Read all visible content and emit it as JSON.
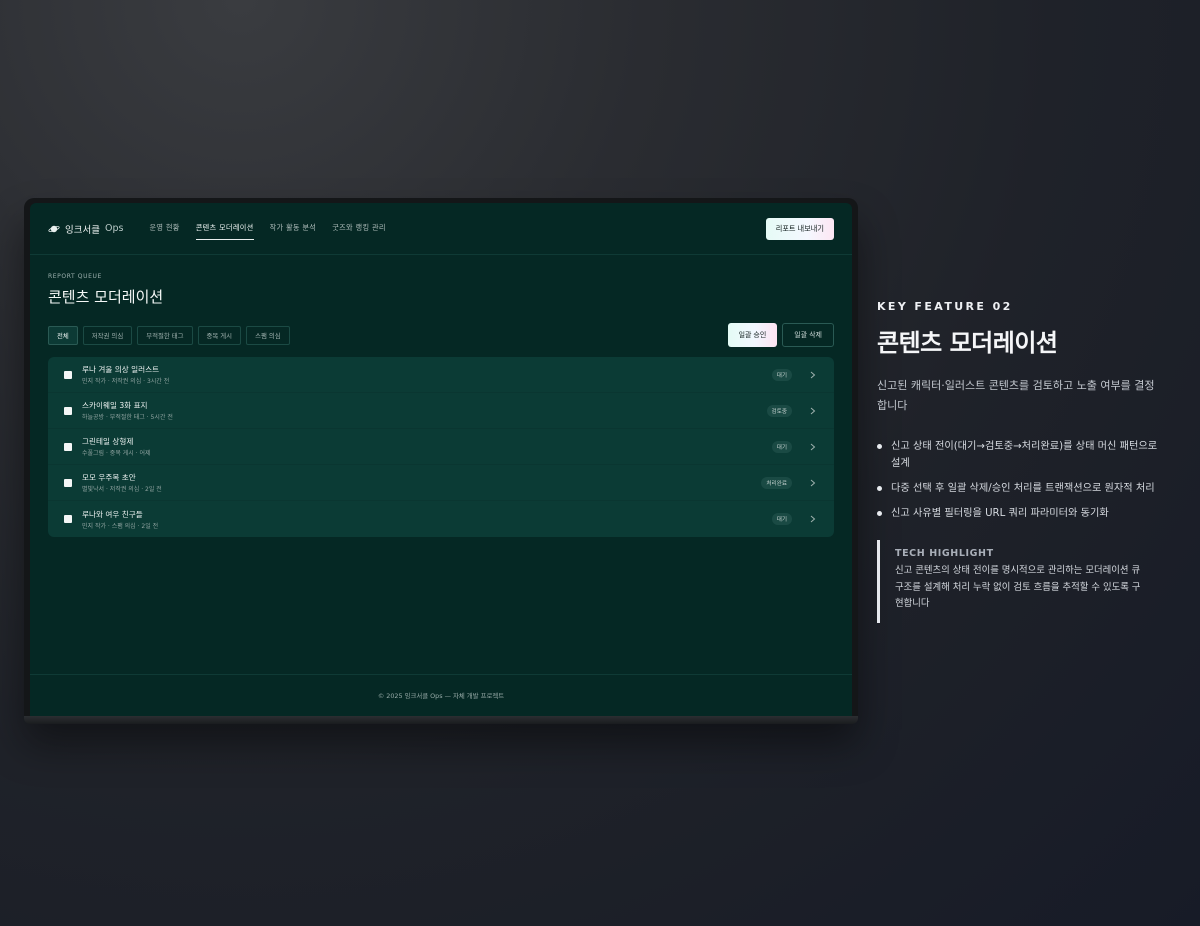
{
  "app": {
    "brand_name": "잉크서클",
    "brand_suffix": "Ops",
    "nav": [
      {
        "label": "운영 현황"
      },
      {
        "label": "콘텐츠 모더레이션"
      },
      {
        "label": "작가 활동 분석"
      },
      {
        "label": "굿즈와 랭킹 관리"
      }
    ],
    "export_label": "리포트 내보내기"
  },
  "page": {
    "eyebrow": "REPORT QUEUE",
    "title": "콘텐츠 모더레이션"
  },
  "filters": [
    {
      "label": "전체"
    },
    {
      "label": "저작권 의심"
    },
    {
      "label": "부적절한 태그"
    },
    {
      "label": "중복 게시"
    },
    {
      "label": "스팸 의심"
    }
  ],
  "actions": {
    "approve_label": "일괄 승인",
    "delete_label": "일괄 삭제"
  },
  "reports": [
    {
      "title": "루나 겨울 의상 일러스트",
      "meta": "민지 작가 · 저작권 의심 · 3시간 전",
      "status": "대기"
    },
    {
      "title": "스카이웨일 3화 표지",
      "meta": "하늘공방 · 부적절한 태그 · 5시간 전",
      "status": "검토중"
    },
    {
      "title": "그린테일 상형제",
      "meta": "수풀그림 · 중복 게시 · 어제",
      "status": "대기"
    },
    {
      "title": "모모 우주복 초안",
      "meta": "별빛낙서 · 저작권 의심 · 2일 전",
      "status": "처리완료"
    },
    {
      "title": "루나와 여우 친구들",
      "meta": "민지 작가 · 스팸 의심 · 2일 전",
      "status": "대기"
    }
  ],
  "footer": "© 2025 잉크서클 Ops — 자체 개발 프로젝트",
  "feature": {
    "eyebrow": "KEY FEATURE 02",
    "title": "콘텐츠 모더레이션",
    "description": "신고된 캐릭터·일러스트 콘텐츠를 검토하고 노출 여부를 결정합니다",
    "bullets": [
      "신고 상태 전이(대기→검토중→처리완료)를 상태 머신 패턴으로 설계",
      "다중 선택 후 일괄 삭제/승인 처리를 트랜잭션으로 원자적 처리",
      "신고 사유별 필터링을 URL 쿼리 파라미터와 동기화"
    ],
    "highlight_title": "TECH HIGHLIGHT",
    "highlight_body": "신고 콘텐츠의 상태 전이를 명시적으로 관리하는 모더레이션 큐 구조를 설계해 처리 누락 없이 검토 흐름을 추적할 수 있도록 구현합니다"
  }
}
